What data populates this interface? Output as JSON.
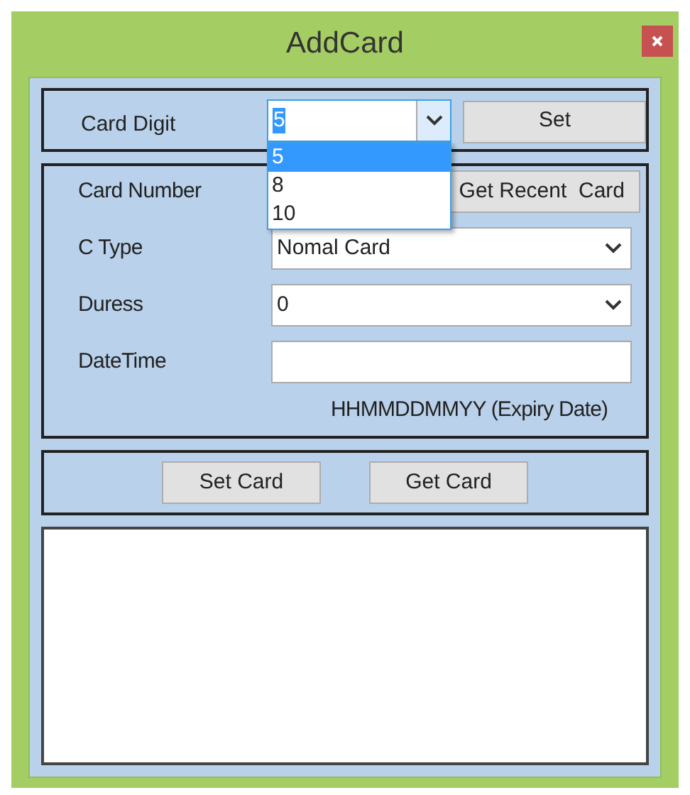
{
  "window": {
    "title": "AddCard"
  },
  "card_digit": {
    "label": "Card Digit",
    "value": "5",
    "expanded": true,
    "options": [
      {
        "label": "5",
        "selected": true
      },
      {
        "label": "8",
        "selected": false
      },
      {
        "label": "10",
        "selected": false
      }
    ]
  },
  "set_button": "Set",
  "fields": [
    {
      "kind": "button",
      "label": "Card Number",
      "button": "Get Recent  Card"
    },
    {
      "kind": "combo",
      "label": "C Type",
      "value": "Nomal Card"
    },
    {
      "kind": "combo",
      "label": "Duress",
      "value": "0"
    },
    {
      "kind": "text",
      "label": "DateTime"
    }
  ],
  "hint": "HHMMDDMMYY (Expiry Date)",
  "actions": [
    "Set Card",
    "Get Card"
  ]
}
